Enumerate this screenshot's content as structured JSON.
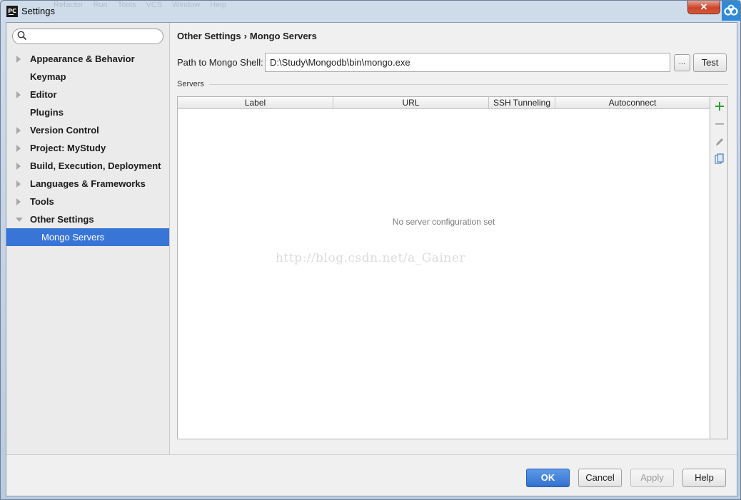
{
  "window": {
    "title": "Settings",
    "app_icon_text": "PC",
    "ghost_menu": [
      "Refactor",
      "Run",
      "Tools",
      "VCS",
      "Window",
      "Help"
    ],
    "close_glyph": "✕"
  },
  "search": {
    "placeholder": ""
  },
  "sidebar": {
    "items": [
      {
        "label": "Appearance & Behavior",
        "expandable": true
      },
      {
        "label": "Keymap",
        "expandable": false
      },
      {
        "label": "Editor",
        "expandable": true
      },
      {
        "label": "Plugins",
        "expandable": false
      },
      {
        "label": "Version Control",
        "expandable": true
      },
      {
        "label": "Project: MyStudy",
        "expandable": true
      },
      {
        "label": "Build, Execution, Deployment",
        "expandable": true
      },
      {
        "label": "Languages & Frameworks",
        "expandable": true
      },
      {
        "label": "Tools",
        "expandable": true
      },
      {
        "label": "Other Settings",
        "expandable": true,
        "expanded": true
      },
      {
        "label": "Mongo Servers",
        "child": true,
        "selected": true
      }
    ]
  },
  "breadcrumb": {
    "parent": "Other Settings",
    "separator": "›",
    "current": "Mongo Servers"
  },
  "mongo": {
    "path_label": "Path to Mongo Shell:",
    "path_value": "D:\\Study\\Mongodb\\bin\\mongo.exe",
    "browse_label": "...",
    "test_label": "Test",
    "servers_caption": "Servers",
    "columns": [
      "Label",
      "URL",
      "SSH Tunneling",
      "Autoconnect"
    ],
    "empty_message": "No server configuration set",
    "watermark": "http://blog.csdn.net/a_Gainer"
  },
  "buttons": {
    "ok": "OK",
    "cancel": "Cancel",
    "apply": "Apply",
    "help": "Help"
  },
  "colors": {
    "selection": "#3875d7",
    "add_icon": "#2e9d3a",
    "ok_button": "#3d7ddb"
  }
}
